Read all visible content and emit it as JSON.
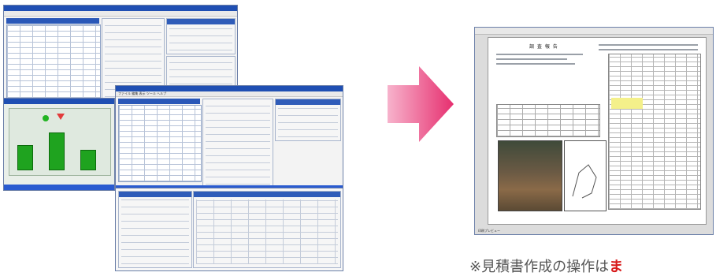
{
  "left_group": {
    "back_window": {
      "title": "",
      "menu": ""
    },
    "front_window": {
      "title": "",
      "menu": "ファイル 編集 表示 ツール ヘルプ"
    },
    "chart_window": {
      "title": ""
    },
    "lower_window": {
      "title": ""
    }
  },
  "arrow": {
    "color": "#ec3a7a",
    "icon": "right-arrow-icon"
  },
  "right_doc": {
    "heading": "調 査 報 告",
    "bottom_left": "印刷プレビュー"
  },
  "caption": {
    "prefix": "※見積書作成の操作は",
    "highlight": "ま"
  }
}
